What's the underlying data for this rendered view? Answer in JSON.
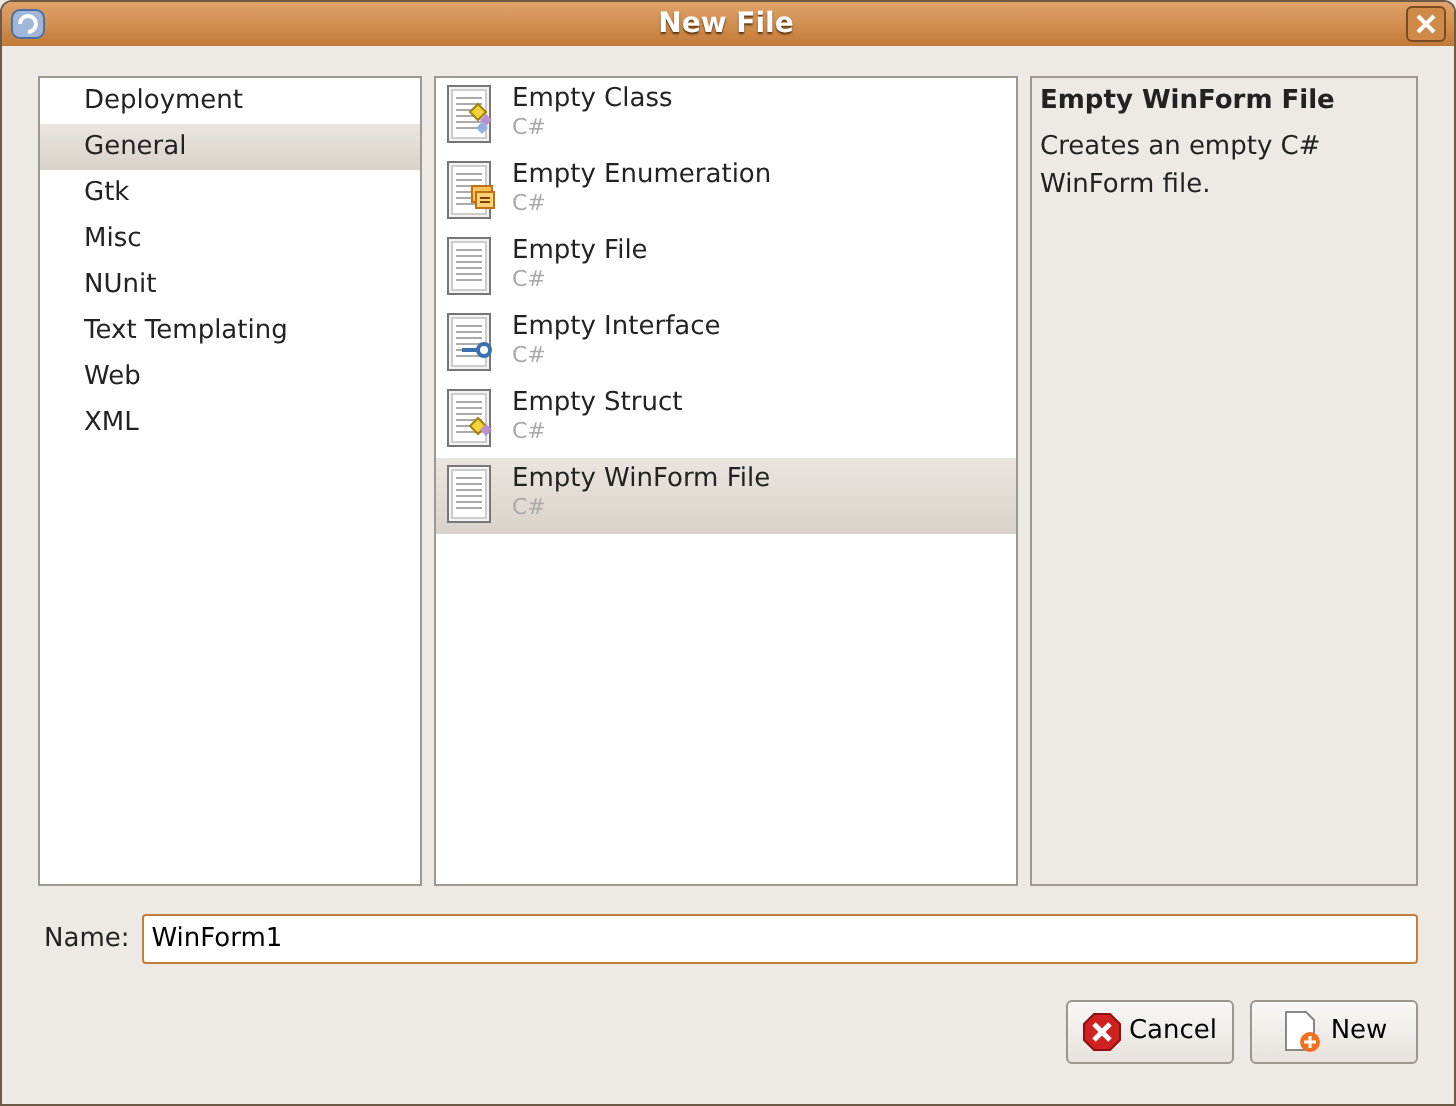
{
  "window": {
    "title": "New File"
  },
  "categories": [
    {
      "label": "Deployment",
      "selected": false
    },
    {
      "label": "General",
      "selected": true
    },
    {
      "label": "Gtk",
      "selected": false
    },
    {
      "label": "Misc",
      "selected": false
    },
    {
      "label": "NUnit",
      "selected": false
    },
    {
      "label": "Text Templating",
      "selected": false
    },
    {
      "label": "Web",
      "selected": false
    },
    {
      "label": "XML",
      "selected": false
    }
  ],
  "templates": [
    {
      "name": "Empty Class",
      "language": "C#",
      "kind": "class",
      "selected": false
    },
    {
      "name": "Empty Enumeration",
      "language": "C#",
      "kind": "enum",
      "selected": false
    },
    {
      "name": "Empty File",
      "language": "C#",
      "kind": "file",
      "selected": false
    },
    {
      "name": "Empty Interface",
      "language": "C#",
      "kind": "interface",
      "selected": false
    },
    {
      "name": "Empty Struct",
      "language": "C#",
      "kind": "struct",
      "selected": false
    },
    {
      "name": "Empty WinForm File",
      "language": "C#",
      "kind": "file",
      "selected": true
    }
  ],
  "description": {
    "title": "Empty WinForm File",
    "text": "Creates an empty C# WinForm file."
  },
  "name_field": {
    "label": "Name:",
    "value": "WinForm1"
  },
  "buttons": [
    {
      "label": "Cancel",
      "kind": "cancel"
    },
    {
      "label": "New",
      "kind": "new"
    }
  ]
}
